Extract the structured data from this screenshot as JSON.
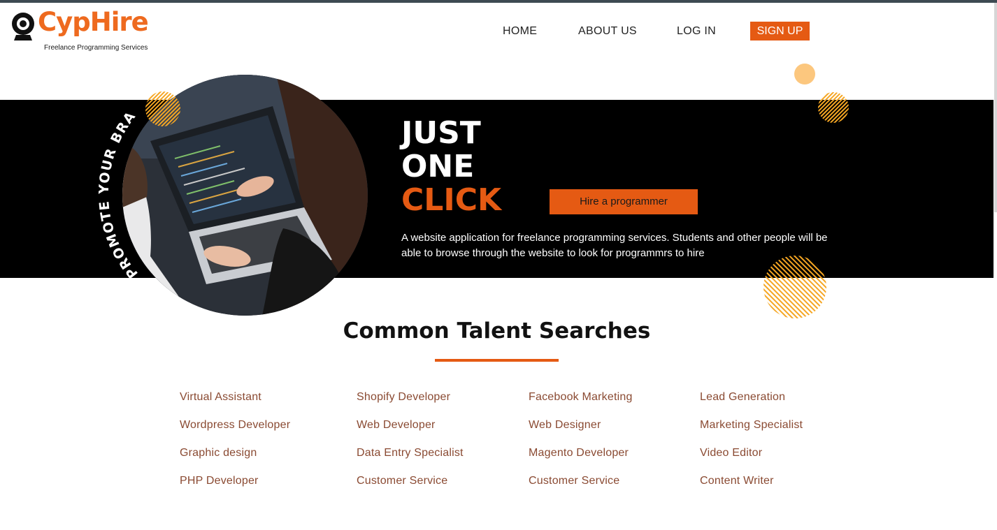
{
  "brand": {
    "name": "CypHire",
    "tagline": "Freelance Programming Services",
    "accent": "#e55a13"
  },
  "nav": {
    "home": "HOME",
    "about": "ABOUT US",
    "login": "LOG IN",
    "signup": "SIGN UP"
  },
  "hero": {
    "badge_text": "PROMOTE YOUR BRAND",
    "title_line1": "JUST",
    "title_line2": "ONE",
    "title_line3": "CLICK",
    "cta_label": "Hire a programmer",
    "description": "A website application for freelance programming services. Students and other people will be able to browse through the website to look for programmrs to hire"
  },
  "talent": {
    "title": "Common Talent Searches",
    "columns": [
      [
        "Virtual Assistant",
        "Wordpress Developer",
        "Graphic design",
        "PHP Developer"
      ],
      [
        "Shopify Developer",
        "Web Developer",
        "Data Entry Specialist",
        "Customer Service"
      ],
      [
        "Facebook Marketing",
        "Web Designer",
        "Magento Developer",
        "Customer Service"
      ],
      [
        "Lead Generation",
        "Marketing Specialist",
        "Video Editor",
        "Content Writer"
      ]
    ]
  }
}
